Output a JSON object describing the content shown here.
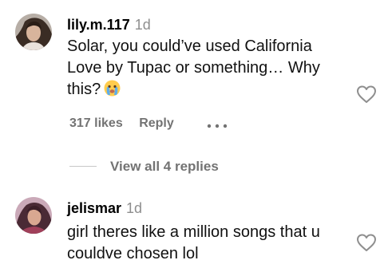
{
  "comments": [
    {
      "username": "lily.m.117",
      "time": "1d",
      "text": "Solar, you could’ve used California Love by Tupac or something… Why this?",
      "emoji": "crying-face-emoji",
      "likes": "317 likes",
      "reply_label": "Reply",
      "view_replies": "View all 4 replies"
    },
    {
      "username": "jelismar",
      "time": "1d",
      "text": "girl theres like a million songs that u couldve chosen lol"
    }
  ],
  "icons": {
    "like": "heart-outline-icon",
    "more": "more-options-icon"
  },
  "colors": {
    "secondary_text": "#737373",
    "timestamp": "#8e8e8e"
  }
}
